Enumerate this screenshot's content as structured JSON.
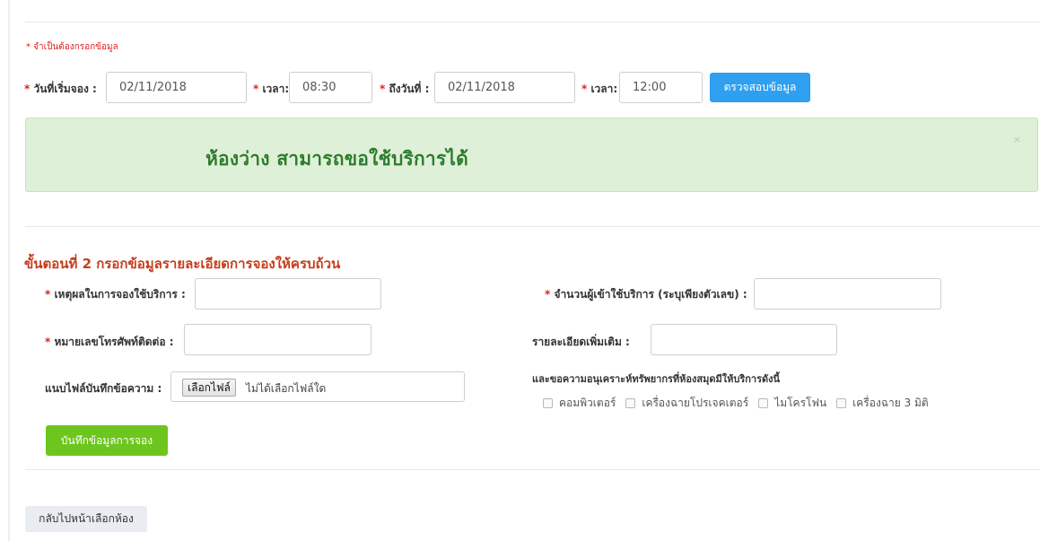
{
  "required_note": "* จำเป็นต้องกรอกข้อมูล",
  "search": {
    "start_date_label": "วันที่เริ่มจอง :",
    "start_date_value": "02/11/2018",
    "start_time_label": "เวลา:",
    "start_time_value": "08:30",
    "end_date_label": "ถึงวันที่ :",
    "end_date_value": "02/11/2018",
    "end_time_label": "เวลา:",
    "end_time_value": "12:00",
    "check_button": "ตรวจสอบข้อมูล"
  },
  "alert": {
    "message": "ห้องว่าง สามารถขอใช้บริการได้",
    "close": "×"
  },
  "step2": {
    "title": "ขั้นตอนที่ 2 กรอกข้อมูลรายละเอียดการจองให้ครบถ้วน",
    "reason_label": "เหตุผลในการจองใช้บริการ :",
    "reason_value": "",
    "attendees_label": "จำนวนผู้เข้าใช้บริการ (ระบุเพียงตัวเลข) :",
    "attendees_value": "",
    "phone_label": "หมายเลขโทรศัพท์ติดต่อ :",
    "phone_value": "",
    "details_label": "รายละเอียดเพิ่มเติม :",
    "details_value": "",
    "attach_label": "แนบไฟล์บันทึกข้อความ :",
    "file_button": "เลือกไฟล์",
    "file_status": "ไม่ได้เลือกไฟล์ใด",
    "resources_title": "และขอความอนุเคราะห์ทรัพยากรที่ห้องสมุดมีให้บริการดังนี้",
    "resources": [
      "คอมพิวเตอร์",
      "เครื่องฉายโปรเจคเตอร์",
      "ไมโครโฟน",
      "เครื่องฉาย 3 มิติ"
    ],
    "save_button": "บันทึกข้อมูลการจอง"
  },
  "back_button": "กลับไปหน้าเลือกห้อง",
  "colors": {
    "required": "#e02020",
    "primary": "#2f9ff2",
    "success_bg": "#dff0d8",
    "success_text": "#2d7d2d",
    "step_title": "#c63d1b",
    "save": "#6dc61d"
  }
}
